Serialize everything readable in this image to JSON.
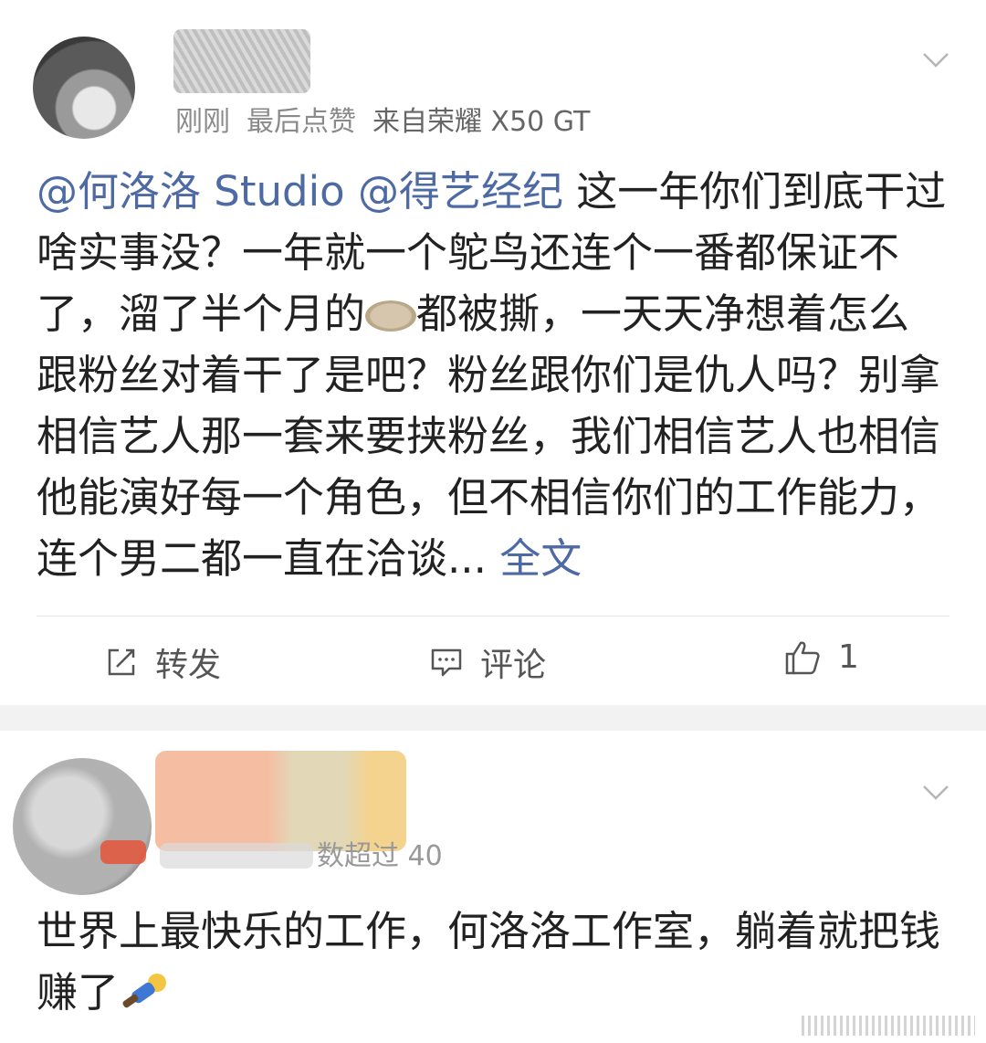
{
  "post1": {
    "meta": {
      "time": "刚刚",
      "like_status": "最后点赞",
      "source": "来自荣耀 X50 GT"
    },
    "content": {
      "mention1": "@何洛洛 Studio",
      "mention2": "@得艺经纪",
      "text_part1": " 这一年你们到底干过啥实事没？一年就一个鸵鸟还连个一番都保证不了，溜了半个月的",
      "emoji": "pie-emoji",
      "text_part2": "都被撕，一天天净想着怎么跟粉丝对着干了是吧？粉丝跟你们是仇人吗？别拿相信艺人那一套来要挟粉丝，我们相信艺人也相信他能演好每一个角色，但不相信你们的工作能力，连个男二都一直在洽谈... ",
      "full_text_link": "全文"
    },
    "actions": {
      "repost": "转发",
      "comment": "评论",
      "like_count": "1"
    }
  },
  "post2": {
    "meta": {
      "visible_fragment": "数超过 40"
    },
    "content": {
      "text": "世界上最快乐的工作，何洛洛工作室，躺着就把钱赚了",
      "emoji": "lying-man-emoji"
    }
  },
  "colors": {
    "link": "#4d6aa5",
    "meta": "#8a8a8a",
    "separator": "#f2f2f2"
  }
}
